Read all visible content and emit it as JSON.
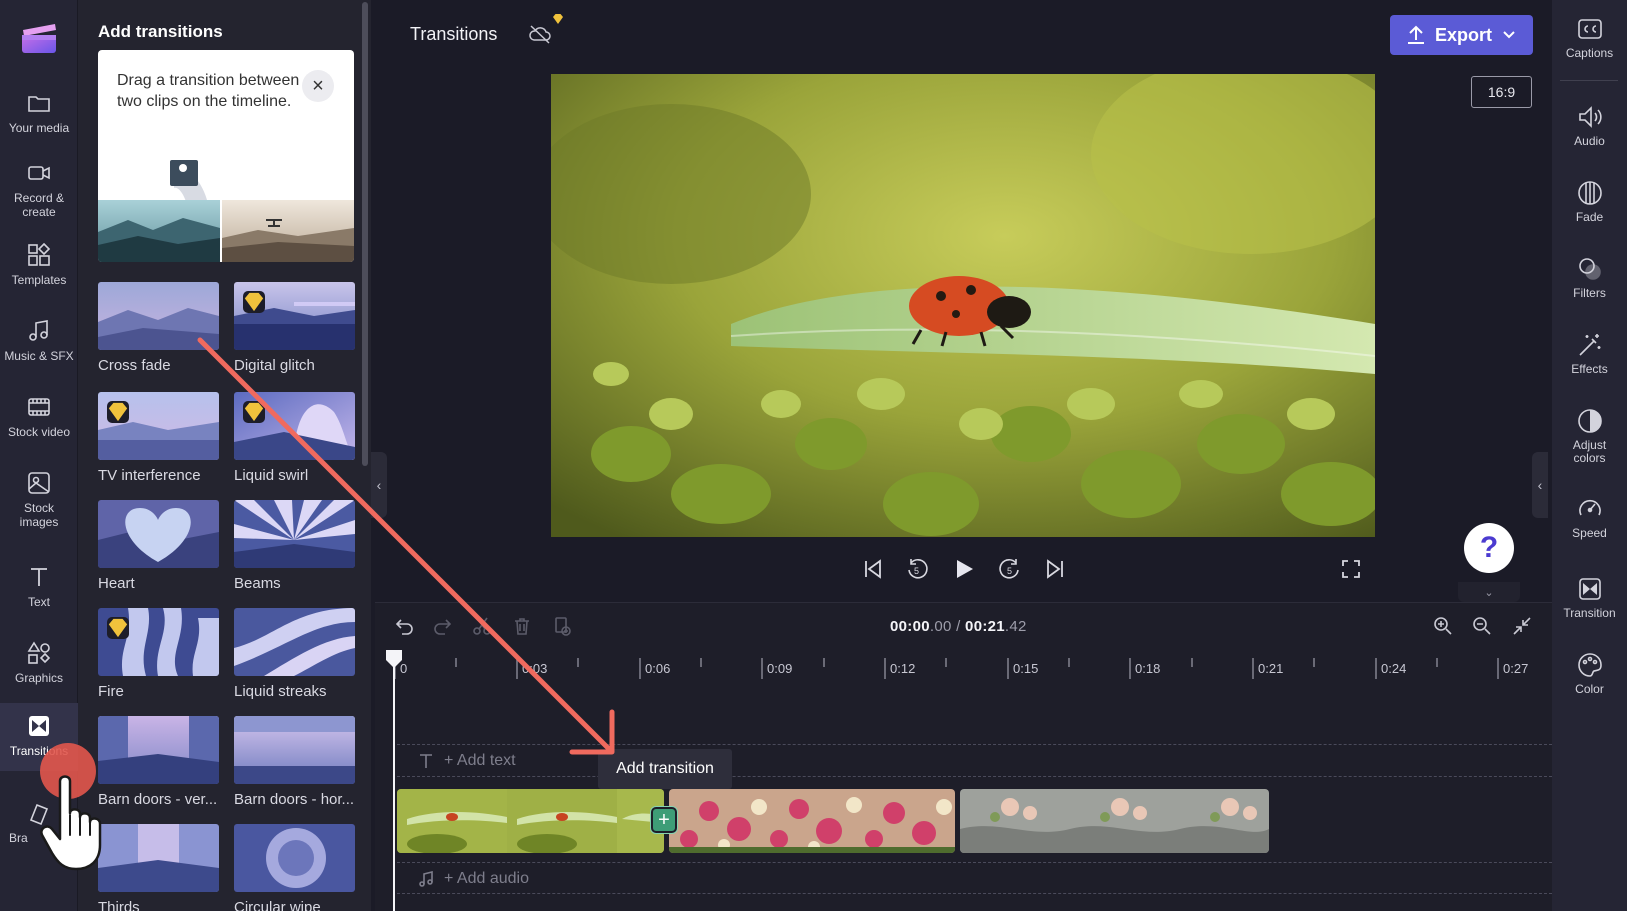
{
  "left_nav": {
    "items": [
      {
        "label": "Your media"
      },
      {
        "label": "Record &\ncreate"
      },
      {
        "label": "Templates"
      },
      {
        "label": "Music & SFX"
      },
      {
        "label": "Stock video"
      },
      {
        "label": "Stock\nimages"
      },
      {
        "label": "Text"
      },
      {
        "label": "Graphics"
      },
      {
        "label": "Transitions"
      },
      {
        "label": "Bra"
      }
    ]
  },
  "panel": {
    "title": "Add transitions",
    "tip_text": "Drag a transition between two clips on the timeline.",
    "tiles": [
      {
        "name": "Cross fade",
        "premium": false
      },
      {
        "name": "Digital glitch",
        "premium": true
      },
      {
        "name": "TV interference",
        "premium": true
      },
      {
        "name": "Liquid swirl",
        "premium": true
      },
      {
        "name": "Heart",
        "premium": false
      },
      {
        "name": "Beams",
        "premium": false
      },
      {
        "name": "Fire",
        "premium": true
      },
      {
        "name": "Liquid streaks",
        "premium": false
      },
      {
        "name": "Barn doors - ver...",
        "premium": false
      },
      {
        "name": "Barn doors - hor...",
        "premium": false
      },
      {
        "name": "Thirds",
        "premium": false
      },
      {
        "name": "Circular wipe",
        "premium": false
      }
    ]
  },
  "topbar": {
    "title": "Transitions",
    "export_label": "Export",
    "aspect_ratio": "16:9"
  },
  "timeline": {
    "current_time_main": "00:00",
    "current_time_frac": ".00",
    "separator": " / ",
    "total_time_main": "00:21",
    "total_time_frac": ".42",
    "ruler_labels": [
      "0",
      "0:03",
      "0:06",
      "0:09",
      "0:12",
      "0:15",
      "0:18",
      "0:21",
      "0:24",
      "0:27"
    ],
    "add_text": "+ Add text",
    "add_audio": "+ Add audio",
    "tooltip": "Add transition"
  },
  "right_rail": {
    "items": [
      {
        "label": "Captions"
      },
      {
        "label": "Audio"
      },
      {
        "label": "Fade"
      },
      {
        "label": "Filters"
      },
      {
        "label": "Effects"
      },
      {
        "label": "Adjust\ncolors"
      },
      {
        "label": "Speed"
      },
      {
        "label": "Transition"
      },
      {
        "label": "Color"
      }
    ]
  },
  "colors": {
    "accent": "#5b5bd6",
    "annotation": "#f06a5e",
    "add_transition": "#3e9d77"
  }
}
